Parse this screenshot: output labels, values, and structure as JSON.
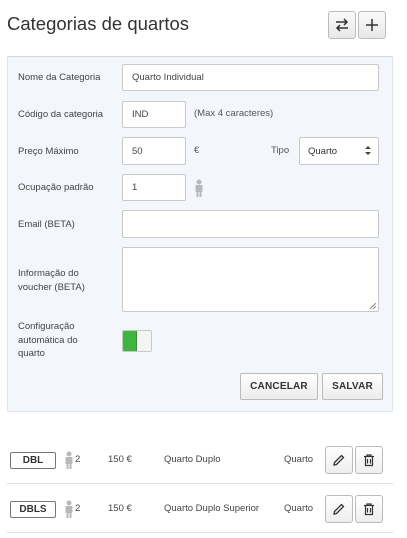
{
  "header": {
    "title": "Categorias de quartos",
    "swap_icon": "swap-arrows-icon",
    "add_icon": "plus-icon"
  },
  "form": {
    "name": {
      "label": "Nome da Categoria",
      "value": "Quarto Individual"
    },
    "code": {
      "label": "Código da categoria",
      "value": "IND",
      "hint": "(Max 4 caracteres)"
    },
    "price": {
      "label": "Preço Máximo",
      "value": "50",
      "currency": "€"
    },
    "type": {
      "label": "Tipo",
      "selected": "Quarto"
    },
    "occupancy": {
      "label": "Ocupação padrão",
      "value": "1"
    },
    "email": {
      "label": "Email (BETA)",
      "value": ""
    },
    "voucher": {
      "label_line1": "Informação do",
      "label_line2": "voucher (BETA)",
      "value": ""
    },
    "auto_config": {
      "label_line1": "Configuração",
      "label_line2": "automática do",
      "label_line3": "quarto",
      "enabled": true
    },
    "cancel_label": "CANCELAR",
    "save_label": "SALVAR"
  },
  "rooms": [
    {
      "code": "DBL",
      "occupancy": "2",
      "price": "150 €",
      "name": "Quarto Duplo",
      "type": "Quarto"
    },
    {
      "code": "DBLS",
      "occupancy": "2",
      "price": "150 €",
      "name": "Quarto Duplo Superior",
      "type": "Quarto"
    }
  ],
  "colors": {
    "panel_bg": "#f3f6fb",
    "toggle_on": "#3fb43f",
    "person_icon": "#b8b8b8"
  }
}
